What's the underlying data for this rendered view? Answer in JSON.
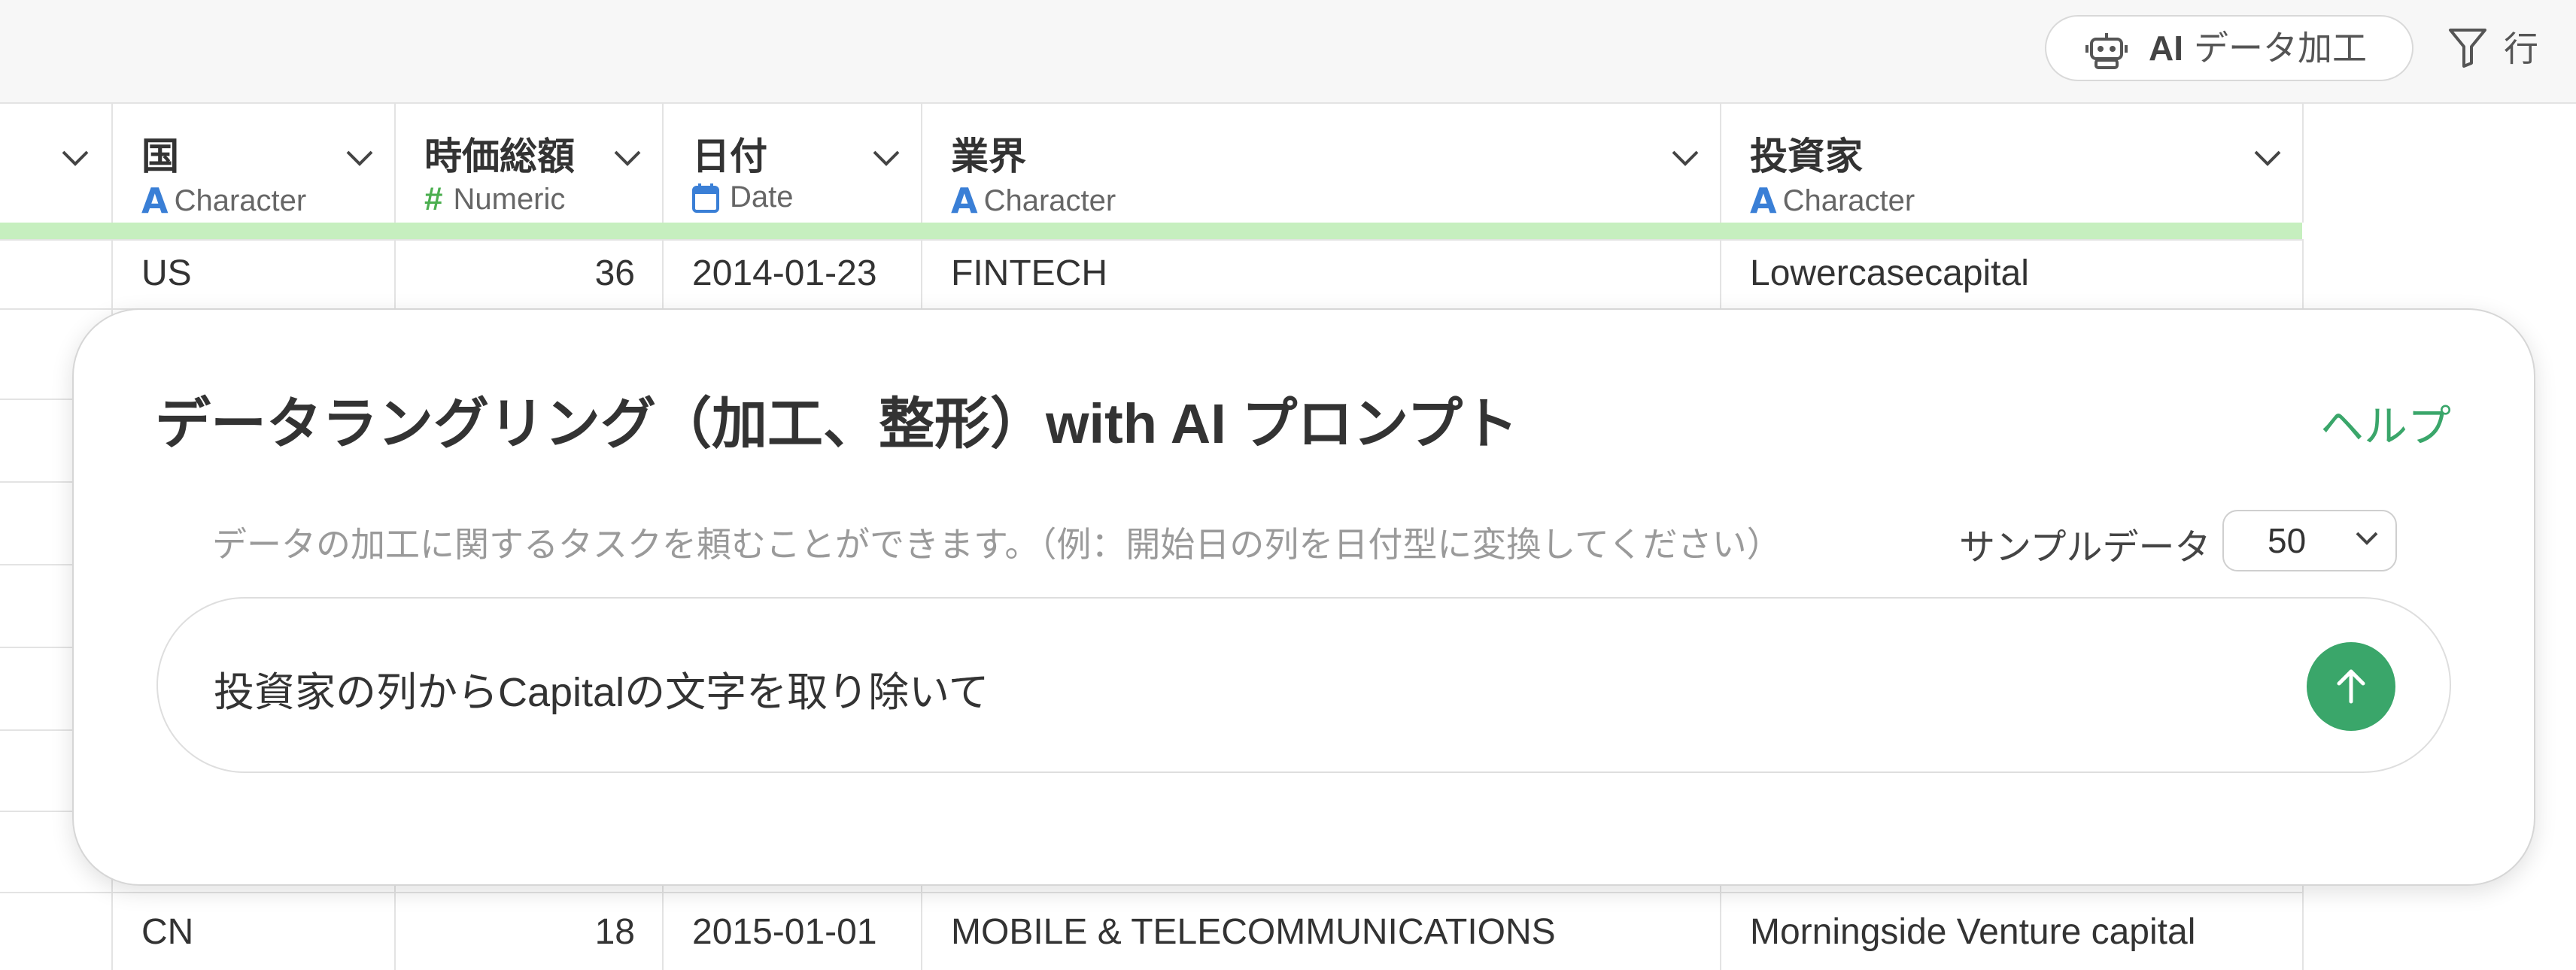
{
  "toolbar": {
    "ai_button_ai": "AI",
    "ai_button_label": "データ加工",
    "row_label": "行"
  },
  "columns": [
    {
      "name": "国",
      "type": "Character",
      "type_icon": "character-icon"
    },
    {
      "name": "時価総額",
      "type": "Numeric",
      "type_icon": "numeric-icon"
    },
    {
      "name": "日付",
      "type": "Date",
      "type_icon": "calendar-icon"
    },
    {
      "name": "業界",
      "type": "Character",
      "type_icon": "character-icon"
    },
    {
      "name": "投資家",
      "type": "Character",
      "type_icon": "character-icon"
    }
  ],
  "rows": [
    {
      "country": "US",
      "market_cap": "36",
      "date": "2014-01-23",
      "industry": "FINTECH",
      "investor": "Lowercasecapital"
    },
    {
      "country": "CN",
      "market_cap": "18",
      "date": "2015-01-01",
      "industry": "MOBILE & TELECOMMUNICATIONS",
      "investor": "Morningside Venture capital"
    }
  ],
  "dialog": {
    "title": "データラングリング（加工、整形）with AI プロンプト",
    "help": "ヘルプ",
    "description": "データの加工に関するタスクを頼むことができます。（例：開始日の列を日付型に変換してください）",
    "sample_label": "サンプルデータ",
    "sample_value": "50",
    "prompt_value": "投資家の列からCapitalの文字を取り除いて"
  },
  "colors": {
    "accent_green": "#3aa66a",
    "header_bar_green": "#c6efbf",
    "character_blue": "#3a7fd6",
    "numeric_green": "#4caf50"
  }
}
